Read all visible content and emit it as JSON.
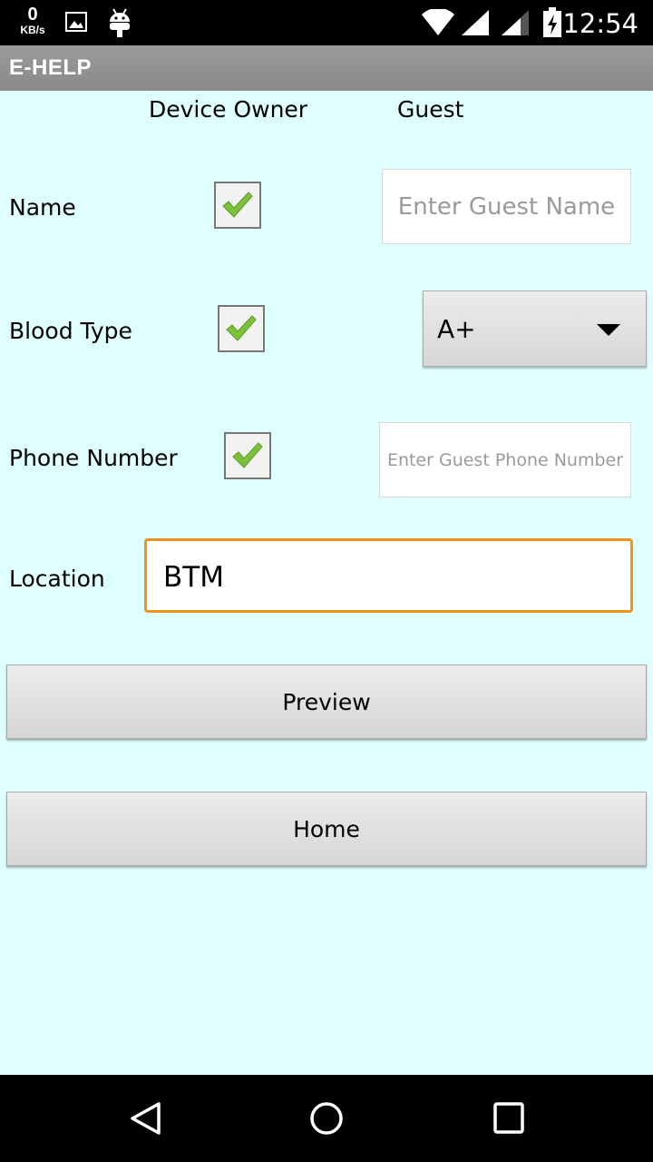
{
  "status_bar": {
    "net_speed_value": "0",
    "net_speed_unit": "KB/s",
    "time": "12:54",
    "icons": [
      "image-icon",
      "android-icon",
      "wifi-icon",
      "signal-icon",
      "signal-icon",
      "battery-charging-icon"
    ]
  },
  "app": {
    "title": "E-HELP"
  },
  "form": {
    "header_owner": "Device Owner",
    "header_guest": "Guest",
    "name_label": "Name",
    "name_owner_checked": true,
    "guest_name_placeholder": "Enter Guest Name",
    "blood_label": "Blood Type",
    "blood_owner_checked": true,
    "blood_selected": "A+",
    "phone_label": "Phone Number",
    "phone_owner_checked": true,
    "guest_phone_placeholder": "Enter Guest Phone Number",
    "location_label": "Location",
    "location_value": "BTM"
  },
  "buttons": {
    "preview": "Preview",
    "home": "Home"
  },
  "colors": {
    "background": "#e0ffff",
    "appbar": "#909090",
    "focus_border": "#f0921c",
    "check": "#7cc13a"
  }
}
